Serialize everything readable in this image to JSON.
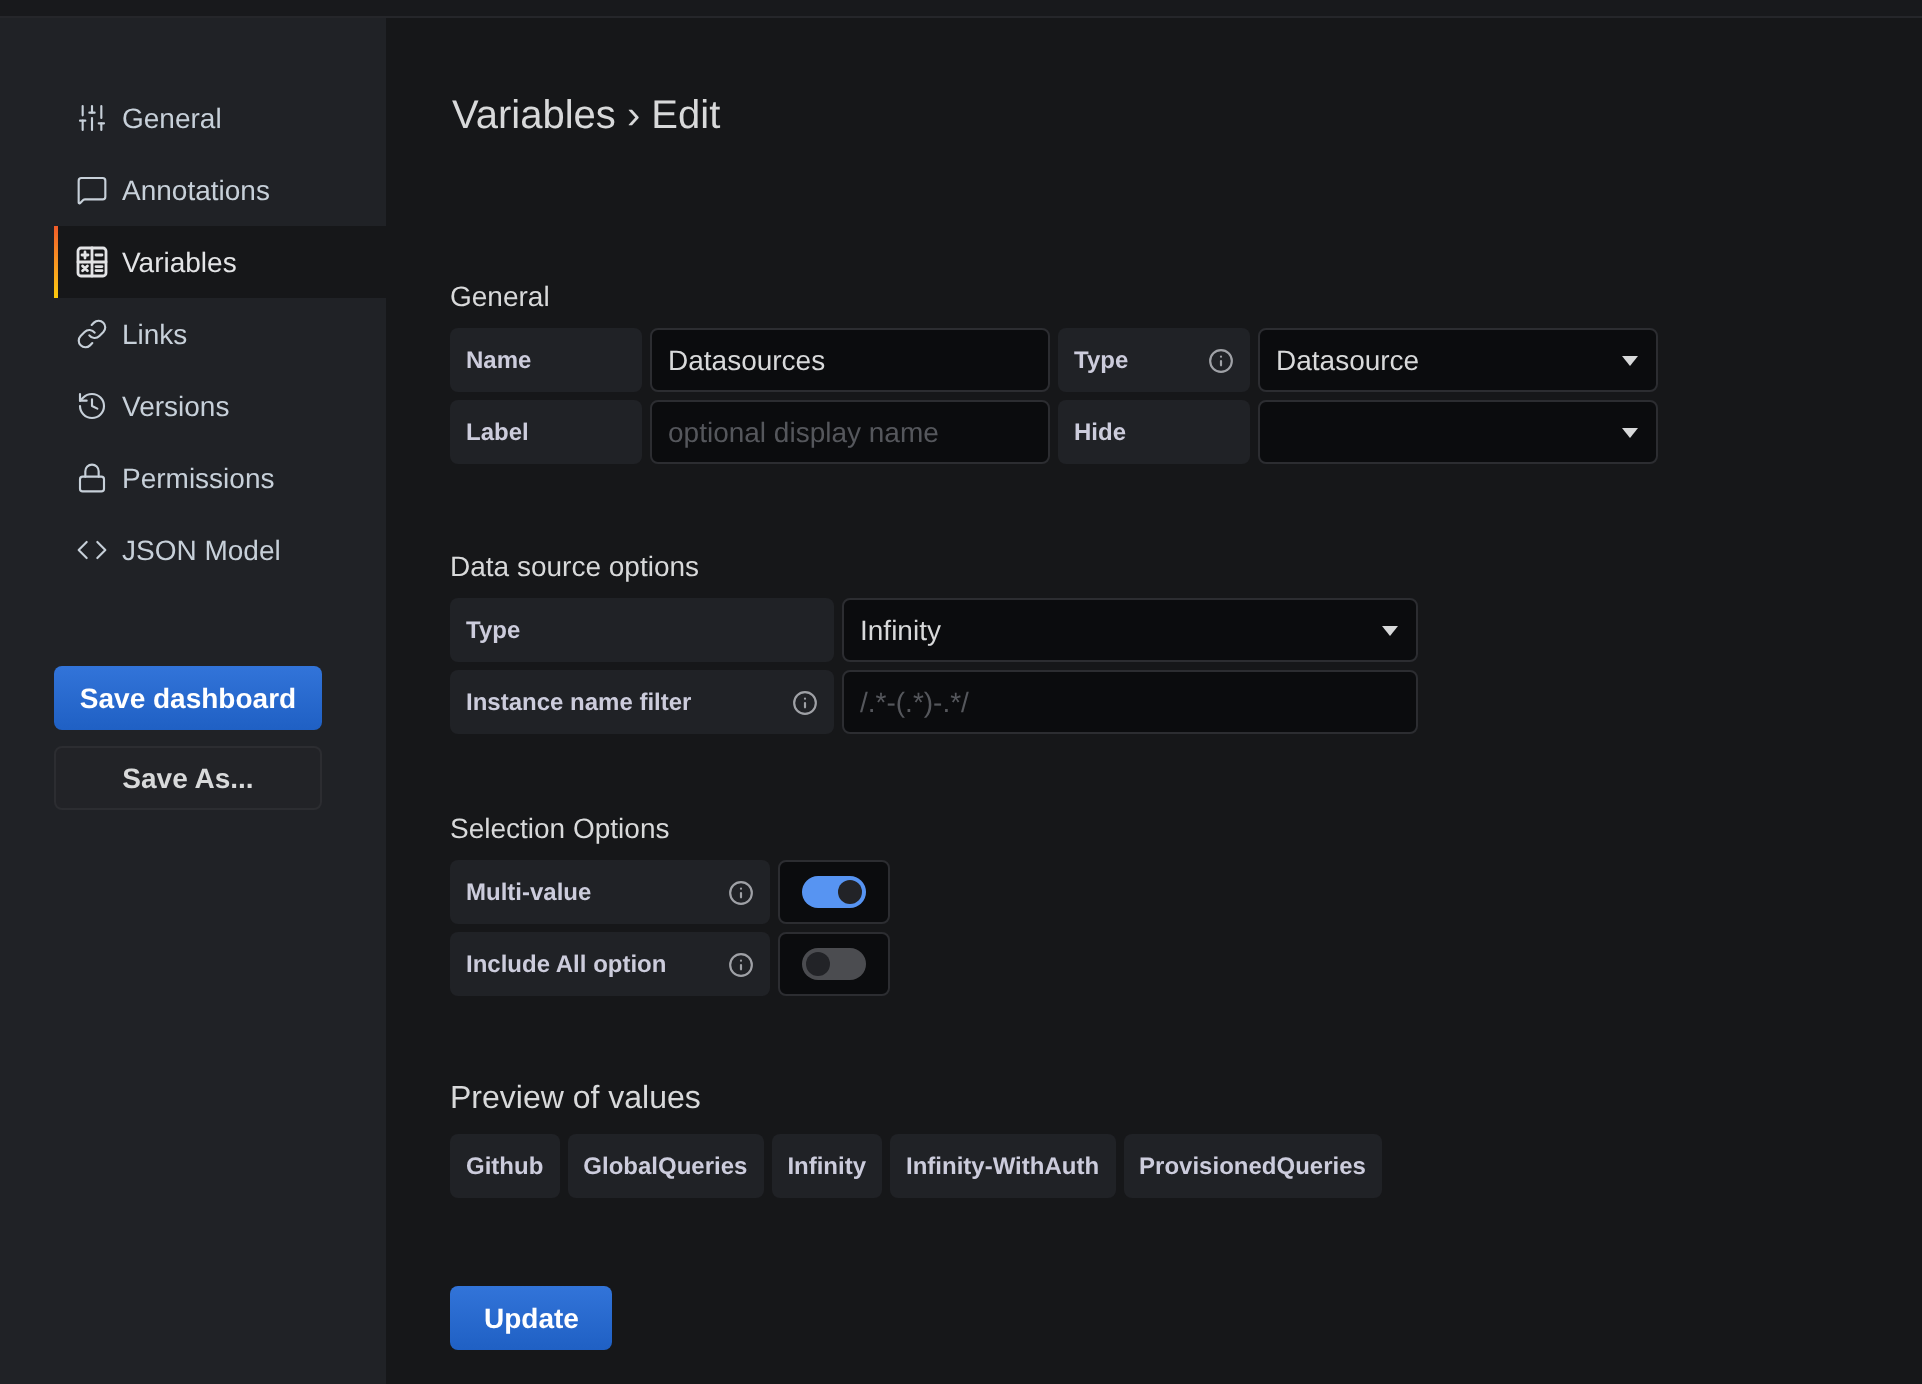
{
  "sidebar": {
    "items": [
      {
        "label": "General",
        "selected": false
      },
      {
        "label": "Annotations",
        "selected": false
      },
      {
        "label": "Variables",
        "selected": true
      },
      {
        "label": "Links",
        "selected": false
      },
      {
        "label": "Versions",
        "selected": false
      },
      {
        "label": "Permissions",
        "selected": false
      },
      {
        "label": "JSON Model",
        "selected": false
      }
    ],
    "buttons": [
      {
        "label": "Save dashboard",
        "kind": "primary"
      },
      {
        "label": "Save As...",
        "kind": "secondary"
      }
    ]
  },
  "title": "Variables › Edit",
  "general": {
    "heading": "General",
    "rows": [
      [
        {
          "label": "Name",
          "info": false,
          "field": {
            "kind": "input",
            "value": "Datasources"
          }
        },
        {
          "label": "Type",
          "info": true,
          "field": {
            "kind": "select",
            "value": "Datasource"
          }
        }
      ],
      [
        {
          "label": "Label",
          "info": false,
          "field": {
            "kind": "input",
            "placeholder": "optional display name"
          }
        },
        {
          "label": "Hide",
          "info": false,
          "field": {
            "kind": "select"
          }
        }
      ]
    ]
  },
  "data_source_options": {
    "heading": "Data source options",
    "rows": [
      [
        {
          "label": "Type",
          "info": false,
          "field": {
            "kind": "select",
            "value": "Infinity"
          }
        }
      ],
      [
        {
          "label": "Instance name filter",
          "info": true,
          "field": {
            "kind": "input",
            "placeholder": "/.*-(.*)-.*/"
          }
        }
      ]
    ]
  },
  "selection_options": {
    "heading": "Selection Options",
    "rows": [
      [
        {
          "label": "Multi-value",
          "info": true,
          "field": {
            "kind": "switch",
            "on": true
          }
        }
      ],
      [
        {
          "label": "Include All option",
          "info": true,
          "field": {
            "kind": "switch",
            "on": false
          }
        }
      ]
    ]
  },
  "preview": {
    "heading": "Preview of values",
    "values": [
      "Github",
      "GlobalQueries",
      "Infinity",
      "Infinity-WithAuth",
      "ProvisionedQueries"
    ]
  },
  "update_button": "Update"
}
